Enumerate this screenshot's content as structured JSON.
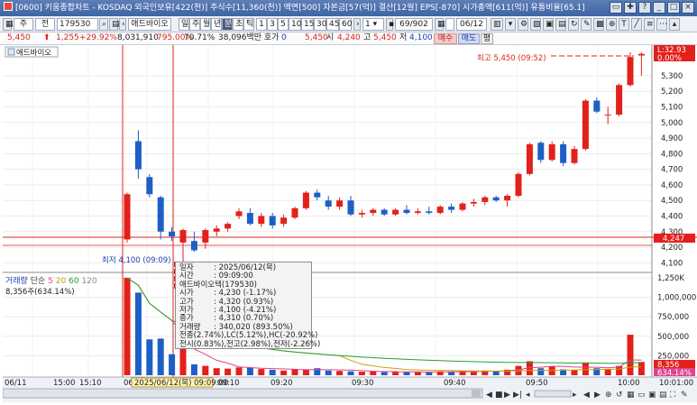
{
  "titlebar": {
    "title": "[0600] 키움종합차트 - KOSDAQ 외국인보유[422(천)] 주식수[11,360(천)] 액면[500] 자본금[57(억)] 결산[12월] EPS[-870] 시가총액[611(억)] 유통비율[65.1]"
  },
  "window_buttons": [
    "▭",
    "✚",
    "?",
    "_",
    "□",
    "×"
  ],
  "toolbar": {
    "type_select": "주",
    "market_select": "전",
    "code": "179530",
    "stock_name": "애드바이오",
    "period_buttons": [
      "일",
      "주",
      "월",
      "년",
      "분",
      "초",
      "틱",
      "1",
      "3",
      "5",
      "10",
      "15",
      "30",
      "45",
      "60",
      "1"
    ],
    "page_count": "69/902",
    "date_value": "06/12"
  },
  "quote": {
    "price": "5,450",
    "change": "1,255",
    "change_pct": "+29.92%",
    "volume": "8,031,910",
    "vol_pct": "795.00%",
    "turnover": "70.71%",
    "amount": "38,096백만 호가",
    "zero": "0",
    "ask": "5,450",
    "open_label": "시",
    "open_value": "4,240",
    "high_label": "고",
    "high_value": "5,450",
    "low_label": "저",
    "low_value": "4,100",
    "buy_label": "매수",
    "sell_label": "매도",
    "pyeong_label": "평"
  },
  "chart": {
    "series_label": "애드바이오",
    "max_label": "최고 5,450 (09:52)",
    "min_label": "최저 4,100 (09:09)",
    "last_price": "4,247",
    "top_price": "L:32.93",
    "top_pct": "0.00%",
    "price_ticks": [
      "5,300",
      "5,200",
      "5,100",
      "5,000",
      "4,900",
      "4,800",
      "4,700",
      "4,600",
      "4,500",
      "4,400",
      "4,300",
      "4,200",
      "4,100"
    ],
    "volume_ticks": [
      "1,250K",
      "1,000,000",
      "750,000",
      "500,000",
      "250,000"
    ],
    "volume_last": "8,356",
    "volume_pct": "634.14%",
    "volume_legend": {
      "label": "거래량",
      "ma_label": "단순",
      "ma": [
        "5",
        "20",
        "60",
        "120"
      ],
      "ma_colors": [
        "#e0428f",
        "#c9a400",
        "#22a03a",
        "#8c8c8c"
      ],
      "value": "8,356주(634.14%)"
    },
    "time_labels": [
      "06/11",
      "15:00",
      "15:10",
      "06",
      "09:10",
      "09:20",
      "09:30",
      "09:40",
      "09:50",
      "10:00",
      "10:01:00"
    ],
    "cursor_time": "2025/06/12(목) 09:09:00"
  },
  "tooltip": {
    "rows": [
      {
        "k": "일자",
        "v": ": 2025/06/12(목)"
      },
      {
        "k": "시간",
        "v": ": 09:09:00"
      },
      {
        "k": "애드바이오텍(179530)",
        "v": ""
      },
      {
        "k": "시가",
        "v": ": 4,230 (-1.17%)"
      },
      {
        "k": "고가",
        "v": ": 4,320 (0.93%)"
      },
      {
        "k": "저가",
        "v": ": 4,100 (-4.21%)"
      },
      {
        "k": "종가",
        "v": ": 4,310 (0.70%)"
      },
      {
        "k": "거래량",
        "v": ": 340,020 (893.50%)"
      }
    ],
    "extra1": "전종(2.74%),LC(5.12%),HC(-20.92%)",
    "extra2": "전시(0.83%),전고(2.98%),전저(-2.26%)"
  },
  "colors": {
    "up": "#e3201b",
    "down": "#1e5fc6",
    "ma5": "#e0428f",
    "ma20": "#c9a400",
    "ma60": "#22a03a"
  },
  "chart_data": {
    "type": "candlestick",
    "price_range": [
      4050,
      5450
    ],
    "volume_range": [
      0,
      1250000
    ],
    "candles": [
      {
        "o": 4250,
        "h": 4550,
        "l": 4230,
        "c": 4540
      },
      {
        "o": 4880,
        "h": 4950,
        "l": 4640,
        "c": 4700
      },
      {
        "o": 4650,
        "h": 4670,
        "l": 4520,
        "c": 4540
      },
      {
        "o": 4520,
        "h": 4530,
        "l": 4250,
        "c": 4300
      },
      {
        "o": 4300,
        "h": 4330,
        "l": 4240,
        "c": 4270
      },
      {
        "o": 4230,
        "h": 4320,
        "l": 4100,
        "c": 4310
      },
      {
        "o": 4240,
        "h": 4300,
        "l": 4170,
        "c": 4180
      },
      {
        "o": 4230,
        "h": 4320,
        "l": 4190,
        "c": 4310
      },
      {
        "o": 4300,
        "h": 4340,
        "l": 4270,
        "c": 4320
      },
      {
        "o": 4320,
        "h": 4360,
        "l": 4300,
        "c": 4350
      },
      {
        "o": 4400,
        "h": 4450,
        "l": 4380,
        "c": 4430
      },
      {
        "o": 4420,
        "h": 4450,
        "l": 4340,
        "c": 4350
      },
      {
        "o": 4350,
        "h": 4420,
        "l": 4330,
        "c": 4400
      },
      {
        "o": 4400,
        "h": 4420,
        "l": 4320,
        "c": 4340
      },
      {
        "o": 4350,
        "h": 4410,
        "l": 4330,
        "c": 4390
      },
      {
        "o": 4390,
        "h": 4460,
        "l": 4380,
        "c": 4450
      },
      {
        "o": 4450,
        "h": 4560,
        "l": 4440,
        "c": 4550
      },
      {
        "o": 4550,
        "h": 4570,
        "l": 4500,
        "c": 4520
      },
      {
        "o": 4500,
        "h": 4530,
        "l": 4440,
        "c": 4460
      },
      {
        "o": 4460,
        "h": 4520,
        "l": 4440,
        "c": 4500
      },
      {
        "o": 4500,
        "h": 4530,
        "l": 4400,
        "c": 4410
      },
      {
        "o": 4410,
        "h": 4440,
        "l": 4390,
        "c": 4420
      },
      {
        "o": 4420,
        "h": 4450,
        "l": 4400,
        "c": 4440
      },
      {
        "o": 4440,
        "h": 4450,
        "l": 4400,
        "c": 4410
      },
      {
        "o": 4410,
        "h": 4450,
        "l": 4400,
        "c": 4440
      },
      {
        "o": 4440,
        "h": 4470,
        "l": 4410,
        "c": 4420
      },
      {
        "o": 4420,
        "h": 4450,
        "l": 4410,
        "c": 4430
      },
      {
        "o": 4430,
        "h": 4460,
        "l": 4410,
        "c": 4420
      },
      {
        "o": 4420,
        "h": 4470,
        "l": 4410,
        "c": 4460
      },
      {
        "o": 4460,
        "h": 4480,
        "l": 4420,
        "c": 4440
      },
      {
        "o": 4440,
        "h": 4490,
        "l": 4430,
        "c": 4480
      },
      {
        "o": 4480,
        "h": 4510,
        "l": 4460,
        "c": 4490
      },
      {
        "o": 4490,
        "h": 4530,
        "l": 4470,
        "c": 4520
      },
      {
        "o": 4520,
        "h": 4530,
        "l": 4490,
        "c": 4500
      },
      {
        "o": 4500,
        "h": 4540,
        "l": 4460,
        "c": 4530
      },
      {
        "o": 4530,
        "h": 4680,
        "l": 4520,
        "c": 4670
      },
      {
        "o": 4670,
        "h": 4870,
        "l": 4660,
        "c": 4860
      },
      {
        "o": 4870,
        "h": 4880,
        "l": 4740,
        "c": 4760
      },
      {
        "o": 4760,
        "h": 4880,
        "l": 4750,
        "c": 4860
      },
      {
        "o": 4860,
        "h": 4880,
        "l": 4720,
        "c": 4740
      },
      {
        "o": 4740,
        "h": 4850,
        "l": 4730,
        "c": 4830
      },
      {
        "o": 4830,
        "h": 5150,
        "l": 4820,
        "c": 5140
      },
      {
        "o": 5140,
        "h": 5160,
        "l": 5060,
        "c": 5070
      },
      {
        "o": 5050,
        "h": 5100,
        "l": 4990,
        "c": 5050
      },
      {
        "o": 5050,
        "h": 5250,
        "l": 5040,
        "c": 5240
      },
      {
        "o": 5240,
        "h": 5450,
        "l": 5230,
        "c": 5420
      },
      {
        "o": 5430,
        "h": 5450,
        "l": 5300,
        "c": 5440
      }
    ],
    "volumes": [
      1250000,
      1060000,
      460000,
      470000,
      270000,
      340020,
      140000,
      120000,
      90000,
      85000,
      100000,
      95000,
      80000,
      70000,
      60000,
      75000,
      70000,
      90000,
      60000,
      55000,
      50000,
      45000,
      48000,
      40000,
      45000,
      40000,
      42000,
      38000,
      50000,
      48000,
      52000,
      45000,
      60000,
      55000,
      70000,
      120000,
      180000,
      90000,
      110000,
      75000,
      70000,
      165000,
      90000,
      80000,
      120000,
      520000,
      170000
    ]
  }
}
